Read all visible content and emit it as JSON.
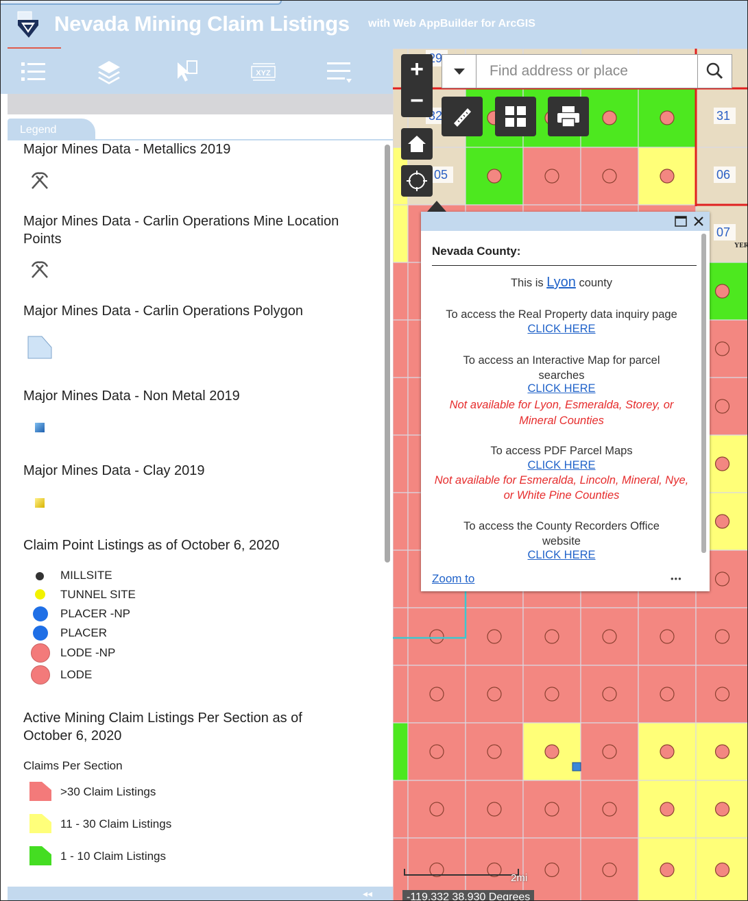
{
  "header": {
    "title": "Nevada Mining Claim Listings",
    "subtitle": "with Web AppBuilder for ArcGIS"
  },
  "toolbar": {
    "tools": [
      "legend-icon",
      "layers-icon",
      "select-icon",
      "coordinate-icon",
      "menu-icon"
    ]
  },
  "legend": {
    "tab_label": "Legend",
    "layers": [
      {
        "title": "Major Mines Data - Metallics 2019",
        "symbol": "mining-picks-icon"
      },
      {
        "title": "Major Mines Data - Carlin Operations Mine Location Points",
        "symbol": "mining-picks-icon"
      },
      {
        "title": "Major Mines Data - Carlin Operations Polygon",
        "symbol": "polygon-swatch"
      },
      {
        "title": "Major Mines Data - Non Metal 2019",
        "symbol": "blue-square"
      },
      {
        "title": "Major Mines Data - Clay 2019",
        "symbol": "yellow-square"
      },
      {
        "title": "Claim Point Listings as of October 6, 2020"
      },
      {
        "title": "Active Mining Claim Listings Per Section as of October 6, 2020"
      }
    ],
    "claim_points": [
      {
        "label": "MILLSITE",
        "color": "#333333"
      },
      {
        "label": "TUNNEL SITE",
        "color": "#f2f200"
      },
      {
        "label": "PLACER -NP",
        "color": "#1f6fe6"
      },
      {
        "label": "PLACER",
        "color": "#1f6fe6"
      },
      {
        "label": "LODE -NP",
        "color": "#f37a7a"
      },
      {
        "label": "LODE",
        "color": "#f37a7a"
      }
    ],
    "claims_per_section_label": "Claims Per Section",
    "claims_per_section": [
      {
        "label": ">30 Claim Listings",
        "color": "#f37a7a"
      },
      {
        "label": "11 - 30 Claim Listings",
        "color": "#ffff7a"
      },
      {
        "label": "1 - 10 Claim Listings",
        "color": "#44dd22"
      }
    ]
  },
  "map": {
    "search_placeholder": "Find address or place",
    "section_labels": [
      "31",
      "06",
      "07",
      "32",
      "05",
      "29"
    ],
    "map_label": "YER IND",
    "scale_label": "2mi",
    "coords": "-119.332 38.930 Degrees",
    "colors": {
      "red": "#f38781",
      "yellow": "#ffff78",
      "green": "#4de81f"
    }
  },
  "popup": {
    "heading": "Nevada County:",
    "county_intro": "This is",
    "county_name": "Lyon",
    "county_suffix": "county",
    "real_property_text": "To access the Real Property data inquiry page",
    "interactive_map_text": "To access an Interactive Map for parcel searches",
    "interactive_note": "Not available for Lyon, Esmeralda, Storey, or Mineral Counties",
    "pdf_text": "To access PDF Parcel Maps",
    "pdf_note": "Not available for Esmeralda, Lincoln, Mineral, Nye, or White Pine Counties",
    "recorder_text": "To access the County Recorders Office website",
    "click_here": "CLICK HERE",
    "zoom_to": "Zoom to",
    "more": "•••"
  }
}
